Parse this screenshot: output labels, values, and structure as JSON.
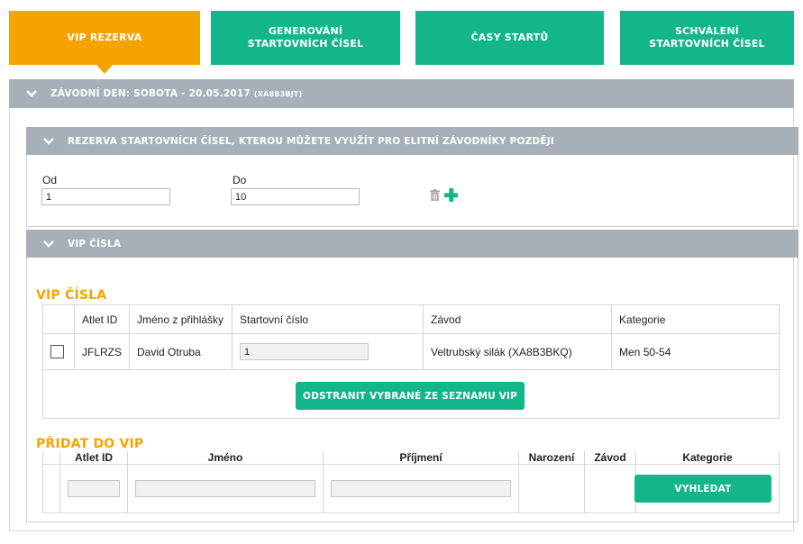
{
  "tabs": [
    {
      "label": "VIP REZERVA"
    },
    {
      "label": "GENEROVÁNÍ STARTOVNÍCH ČÍSEL"
    },
    {
      "label": "ČASY STARTŮ"
    },
    {
      "label": "SCHVÁLENÍ STARTOVNÍCH ČÍSEL"
    }
  ],
  "race_day": {
    "label": "ZÁVODNÍ DEN: SOBOTA - 20.05.2017",
    "code": "(XA8B3BJT)"
  },
  "reserve": {
    "header": "REZERVA STARTOVNÍCH ČÍSEL, KTEROU MŮŽETE VYUŽÍT PRO ELITNÍ ZÁVODNÍKY POZDĚJI",
    "from_label": "Od",
    "from_value": "1",
    "to_label": "Do",
    "to_value": "10"
  },
  "vip_section": {
    "header": "VIP ČÍSLA"
  },
  "vip_list": {
    "title": "VIP ČÍSLA",
    "columns": [
      "Atlet ID",
      "Jméno z přihlášky",
      "Startovní číslo",
      "Závod",
      "Kategorie"
    ],
    "rows": [
      {
        "atlet_id": "JFLRZS",
        "name": "David Otruba",
        "start_number": "1",
        "race": "Veltrubský silák (XA8B3BKQ)",
        "category": "Men 50-54"
      }
    ],
    "remove_button": "ODSTRANIT VYBRANÉ ZE SEZNAMU VIP"
  },
  "add_vip": {
    "title": "PŘIDAT DO VIP",
    "columns": [
      "Atlet ID",
      "Jméno",
      "Příjmení",
      "Narození",
      "Závod",
      "Kategorie"
    ],
    "search_button": "VYHLEDAT"
  },
  "colors": {
    "accent_orange": "#f5a300",
    "accent_green": "#13b58a",
    "bar_grey": "#a7b0b7"
  },
  "icons": [
    "chevron-down-icon",
    "trash-icon",
    "plus-icon"
  ]
}
